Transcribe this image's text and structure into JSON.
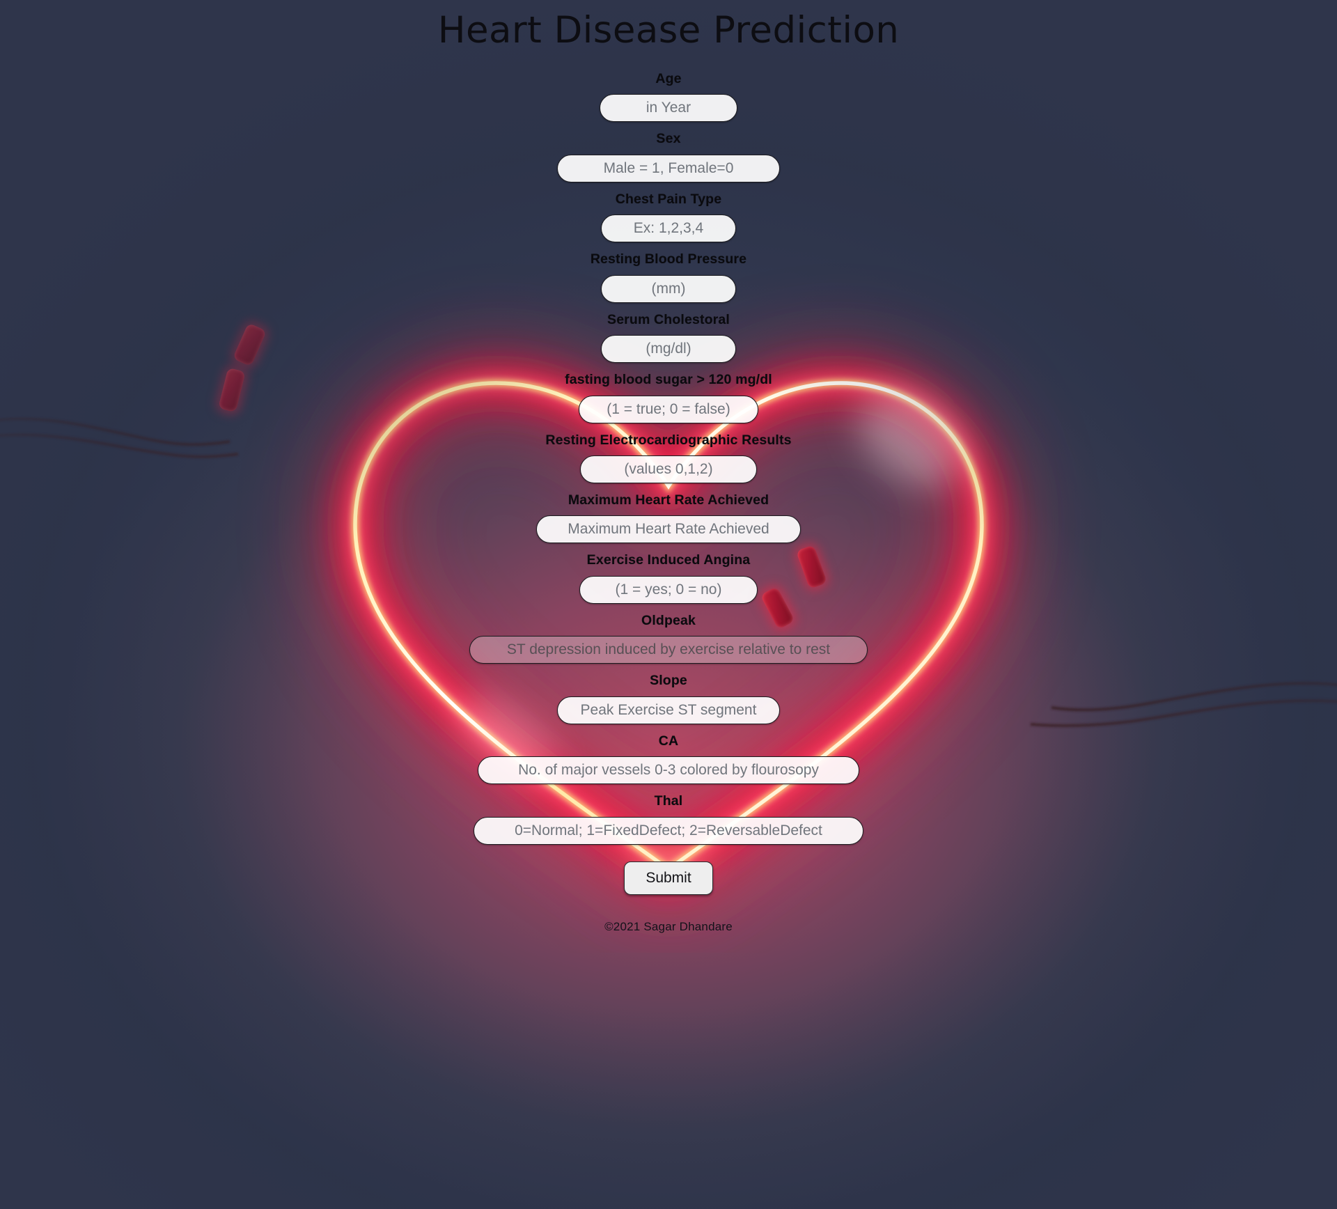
{
  "header": {
    "title": "Heart Disease Prediction"
  },
  "form": {
    "fields": [
      {
        "label": "Age",
        "placeholder": "in Year",
        "name": "age",
        "width": "w-age",
        "translucent": false
      },
      {
        "label": "Sex",
        "placeholder": "Male = 1, Female=0",
        "name": "sex",
        "width": "w-sex",
        "translucent": false
      },
      {
        "label": "Chest Pain Type",
        "placeholder": "Ex: 1,2,3,4",
        "name": "chest-pain-type",
        "width": "w-cp",
        "translucent": false
      },
      {
        "label": "Resting Blood Pressure",
        "placeholder": "(mm)",
        "name": "resting-blood-pressure",
        "width": "w-trest",
        "translucent": false
      },
      {
        "label": "Serum Cholestoral",
        "placeholder": "(mg/dl)",
        "name": "serum-cholestoral",
        "width": "w-chol",
        "translucent": false
      },
      {
        "label": "fasting blood sugar > 120 mg/dl",
        "placeholder": "(1 = true; 0 = false)",
        "name": "fasting-blood-sugar",
        "width": "w-fbs",
        "translucent": false
      },
      {
        "label": "Resting Electrocardiographic Results",
        "placeholder": "(values 0,1,2)",
        "name": "resting-electrocardiographic-results",
        "width": "w-restecg",
        "translucent": false
      },
      {
        "label": "Maximum Heart Rate Achieved",
        "placeholder": "Maximum Heart Rate Achieved",
        "name": "maximum-heart-rate-achieved",
        "width": "w-thalach",
        "translucent": false
      },
      {
        "label": "Exercise Induced Angina",
        "placeholder": "(1 = yes; 0 = no)",
        "name": "exercise-induced-angina",
        "width": "w-exang",
        "translucent": false
      },
      {
        "label": "Oldpeak",
        "placeholder": "ST depression induced by exercise relative to rest",
        "name": "oldpeak",
        "width": "w-oldpeak",
        "translucent": true
      },
      {
        "label": "Slope",
        "placeholder": "Peak Exercise ST segment",
        "name": "slope",
        "width": "w-slope",
        "translucent": false
      },
      {
        "label": "CA",
        "placeholder": "No. of major vessels 0-3 colored by flourosopy",
        "name": "ca",
        "width": "w-ca",
        "translucent": false
      },
      {
        "label": "Thal",
        "placeholder": "0=Normal; 1=FixedDefect; 2=ReversableDefect",
        "name": "thal",
        "width": "w-thal",
        "translucent": false
      }
    ],
    "submit_label": "Submit"
  },
  "footer": {
    "copyright": "©2021 Sagar Dhandare"
  },
  "theme": {
    "background": "#333a52",
    "glow_core": "#fff3b0",
    "glow_red": "#ff1f4d",
    "glow_pink": "#b04a63",
    "label_color": "#0a0a0e",
    "input_bg": "#ffffff",
    "placeholder_color": "#70757c",
    "submit_bg": "#eeeeee"
  }
}
